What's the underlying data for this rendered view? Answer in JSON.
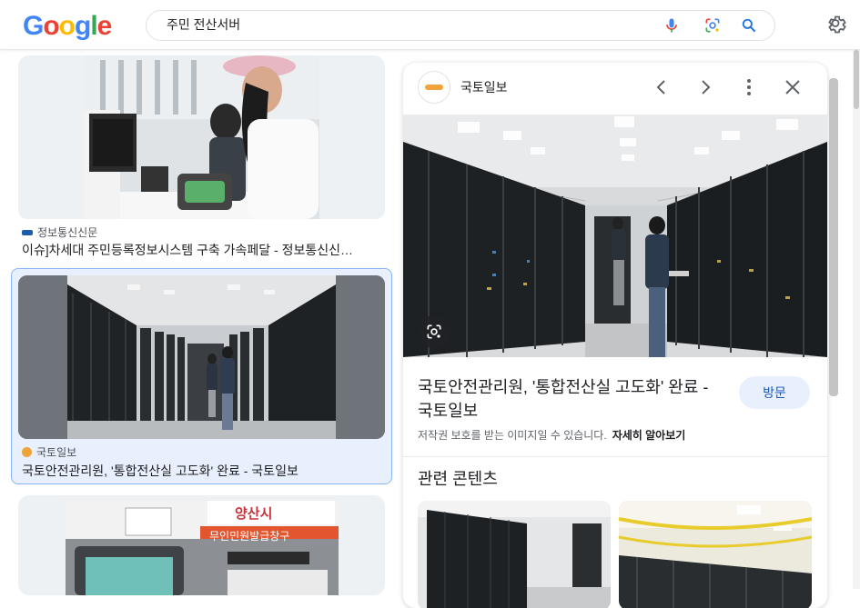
{
  "logo": {
    "letters": [
      "G",
      "o",
      "o",
      "g",
      "l",
      "e"
    ],
    "colors": [
      "#4285F4",
      "#EA4335",
      "#FBBC05",
      "#4285F4",
      "#34A853",
      "#EA4335"
    ]
  },
  "search": {
    "query": "주민 전산서버",
    "icons": [
      "mic-icon",
      "lens-icon",
      "search-icon"
    ]
  },
  "settings_icon": "gear-icon",
  "results": [
    {
      "source": "정보통신신문",
      "title": "이슈]차세대 주민등록정보시스템 구축 가속페달 - 정보통신신…"
    },
    {
      "source": "국토일보",
      "title": "국토안전관리원, '통합전산실 고도화' 완료 - 국토일보",
      "selected": true
    },
    {
      "overlay_text": {
        "sign": "양산시",
        "counter": "무인민원발급창구"
      }
    }
  ],
  "panel": {
    "source": "국토일보",
    "title": "국토안전관리원, '통합전산실 고도화' 완료 - 국토일보",
    "visit_label": "방문",
    "copyright_note": "저작권 보호를 받는 이미지일 수 있습니다.",
    "learn_more": "자세히 알아보기",
    "related_heading": "관련 콘텐츠",
    "nav_icons": [
      "chevron-left-icon",
      "chevron-right-icon",
      "more-vert-icon",
      "close-icon"
    ]
  },
  "colors": {
    "accent": "#1a73e8",
    "selected_bg": "#e8f0fe",
    "selected_border": "#8ab4f8"
  }
}
